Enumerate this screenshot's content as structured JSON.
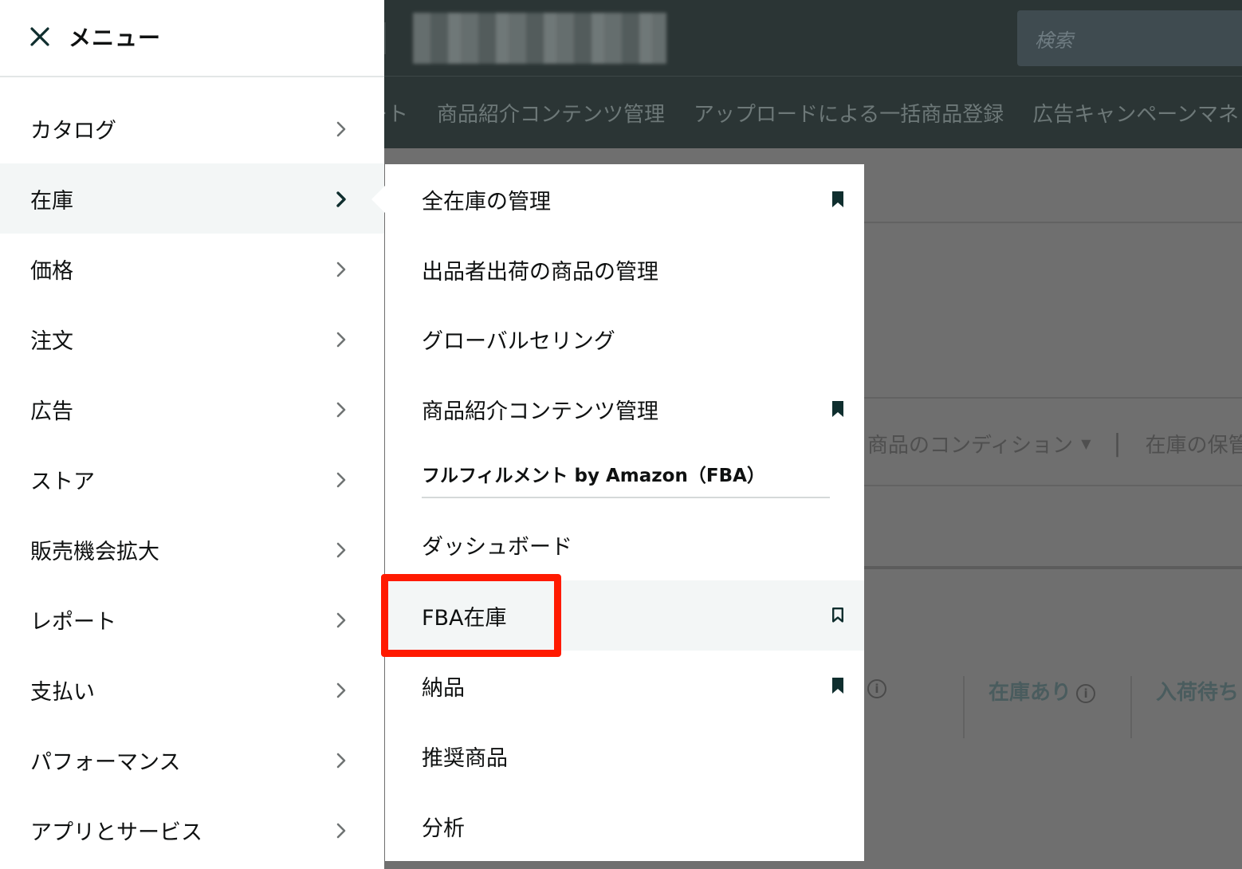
{
  "background": {
    "search_placeholder": "検索",
    "nav_items": [
      "ート",
      "商品紹介コンテンツ管理",
      "アップロードによる一括商品登録",
      "広告キャンペーンマネ"
    ],
    "filter": {
      "condition_label": "商品のコンディション",
      "storage_label": "在庫の保管"
    },
    "stats": {
      "in_stock_label": "在庫あり",
      "inbound_label": "入荷待ち"
    }
  },
  "menu": {
    "title": "メニュー",
    "items": [
      {
        "label": "カタログ"
      },
      {
        "label": "在庫"
      },
      {
        "label": "価格"
      },
      {
        "label": "注文"
      },
      {
        "label": "広告"
      },
      {
        "label": "ストア"
      },
      {
        "label": "販売機会拡大"
      },
      {
        "label": "レポート"
      },
      {
        "label": "支払い"
      },
      {
        "label": "パフォーマンス"
      },
      {
        "label": "アプリとサービス"
      }
    ],
    "active_index": 1
  },
  "submenu": {
    "items": [
      {
        "label": "全在庫の管理",
        "bookmark": "filled"
      },
      {
        "label": "出品者出荷の商品の管理",
        "bookmark": "none"
      },
      {
        "label": "グローバルセリング",
        "bookmark": "none"
      },
      {
        "label": "商品紹介コンテンツ管理",
        "bookmark": "filled"
      }
    ],
    "section_title": "フルフィルメント by Amazon（FBA）",
    "fba_items": [
      {
        "label": "ダッシュボード",
        "bookmark": "none"
      },
      {
        "label": "FBA在庫",
        "bookmark": "outline"
      },
      {
        "label": "納品",
        "bookmark": "filled"
      },
      {
        "label": "推奨商品",
        "bookmark": "none"
      },
      {
        "label": "分析",
        "bookmark": "none"
      }
    ]
  },
  "colors": {
    "highlight_border": "#ff1a00",
    "header_bg": "#2b3535",
    "active_bg": "#f3f6f6",
    "icon": "#0f2e2e"
  }
}
